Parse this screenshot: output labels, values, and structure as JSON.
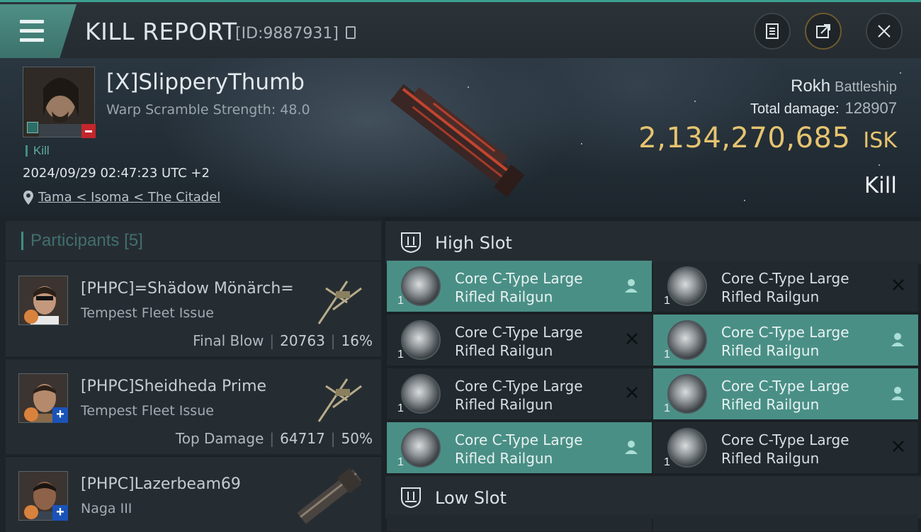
{
  "header": {
    "title": "KILL REPORT",
    "report_id": "[ID:9887931]"
  },
  "victim": {
    "name": "[X]SlipperyThumb",
    "warp_scramble": "Warp Scramble Strength: 48.0",
    "kill_tag": "Kill",
    "datetime": "2024/09/29 02:47:23 UTC +2",
    "location": "Tama < Isoma < The Citadel",
    "ship": "Rokh",
    "ship_class": "Battleship",
    "total_damage_label": "Total damage:",
    "total_damage": "128907",
    "isk_value": "2,134,270,685",
    "isk_unit": "ISK",
    "result": "Kill"
  },
  "participants": {
    "label": "Participants",
    "count": "[5]",
    "rows": [
      {
        "name": "[PHPC]=Shädow Mönärch=",
        "ship": "Tempest Fleet Issue",
        "stat_label": "Final Blow",
        "damage": "20763",
        "percent": "16%"
      },
      {
        "name": "[PHPC]Sheidheda Prime",
        "ship": "Tempest Fleet Issue",
        "stat_label": "Top Damage",
        "damage": "64717",
        "percent": "50%"
      },
      {
        "name": "[PHPC]Lazerbeam69",
        "ship": "Naga III"
      }
    ]
  },
  "slots": {
    "high_label": "High Slot",
    "low_label": "Low Slot",
    "module_name_line1": "Core C-Type Large",
    "module_name_line2": "Rifled Railgun",
    "module_qty": "1",
    "modules": [
      {
        "status": "dropped"
      },
      {
        "status": "destroyed"
      },
      {
        "status": "destroyed"
      },
      {
        "status": "dropped"
      },
      {
        "status": "destroyed"
      },
      {
        "status": "dropped"
      },
      {
        "status": "dropped"
      },
      {
        "status": "destroyed"
      }
    ]
  },
  "colors": {
    "accent": "#3aa08f",
    "isk": "#e6c46f",
    "dropped_bg": "#4a8f86",
    "destroyed_bg": "#222a2f"
  },
  "icons": [
    "menu-icon",
    "copy-icon",
    "clipboard-icon",
    "export-icon",
    "close-icon",
    "map-pin-icon",
    "slot-high-icon",
    "slot-low-icon",
    "pilot-icon",
    "destroyed-x-icon"
  ]
}
